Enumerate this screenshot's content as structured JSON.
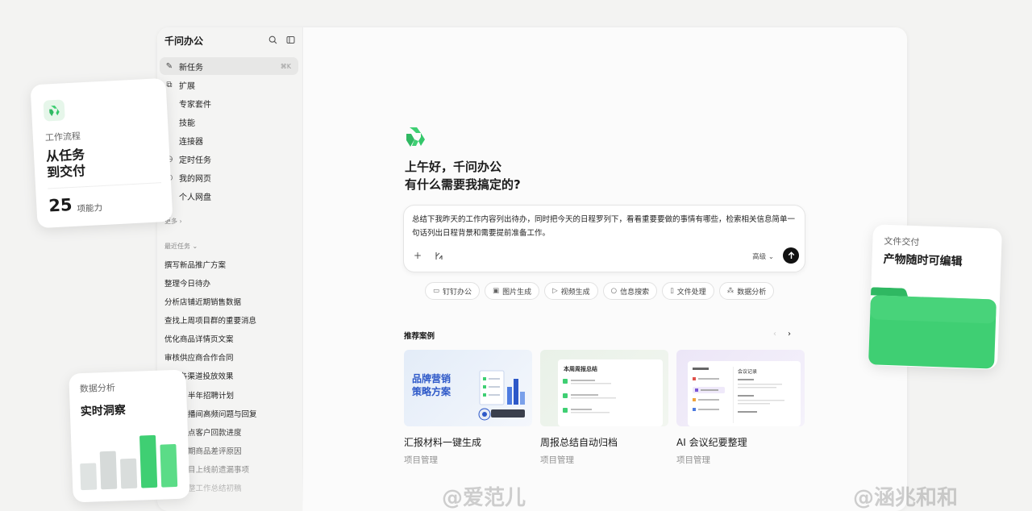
{
  "app": {
    "title": "千问办公",
    "sidebar": {
      "nav": [
        {
          "icon": "edit-icon",
          "label": "新任务",
          "shortcut": "⌘K"
        },
        {
          "icon": "extension-icon",
          "label": "扩展",
          "shortcut": ""
        },
        {
          "icon": "",
          "label": "专家套件",
          "shortcut": ""
        },
        {
          "icon": "",
          "label": "技能",
          "shortcut": ""
        },
        {
          "icon": "",
          "label": "连接器",
          "shortcut": ""
        },
        {
          "icon": "clock-icon",
          "label": "定时任务",
          "shortcut": ""
        },
        {
          "icon": "globe-icon",
          "label": "我的网页",
          "shortcut": ""
        },
        {
          "icon": "",
          "label": "个人网盘",
          "shortcut": ""
        }
      ],
      "more_label": "更多",
      "recent_label": "最近任务",
      "recent_tasks": [
        "撰写新品推广方案",
        "整理今日待办",
        "分析店铺近期销售数据",
        "查找上周项目群的重要消息",
        "优化商品详情页文案",
        "审核供应商合作合同",
        "统计各渠道投放效果",
        "半年招聘计划",
        "播间高频问题与回复",
        "点客户回款进度",
        "期商品差评原因",
        "目上线前遗漏事项",
        "整工作总结初稿"
      ]
    },
    "main": {
      "greeting_line1": "上午好，千问办公",
      "greeting_line2": "有什么需要我搞定的?",
      "prompt_text": "总结下我昨天的工作内容列出待办，同时把今天的日程罗列下，看看重要要做的事情有哪些，检索相关信息简单一句话列出日程背景和需要提前准备工作。",
      "advanced_label": "高级",
      "chips": [
        {
          "icon": "laptop-icon",
          "label": "钉钉办公"
        },
        {
          "icon": "image-icon",
          "label": "图片生成"
        },
        {
          "icon": "video-icon",
          "label": "视频生成"
        },
        {
          "icon": "search-icon",
          "label": "信息搜索"
        },
        {
          "icon": "file-icon",
          "label": "文件处理"
        },
        {
          "icon": "chart-icon",
          "label": "数据分析"
        }
      ],
      "recommend_title": "推荐案例",
      "cases": [
        {
          "title": "汇报材料一键生成",
          "subtitle": "项目管理",
          "thumb_text": "品牌营销\n策略方案"
        },
        {
          "title": "周报总结自动归档",
          "subtitle": "项目管理",
          "thumb_text": "本周周报总结"
        },
        {
          "title": "AI 会议纪要整理",
          "subtitle": "项目管理",
          "thumb_text": "会议记录"
        }
      ]
    }
  },
  "floating_cards": {
    "workflow": {
      "label": "工作流程",
      "headline": "从任务到交付",
      "number": "25",
      "unit": "项能力"
    },
    "analytics": {
      "label": "数据分析",
      "headline": "实时洞察"
    },
    "delivery": {
      "label": "文件交付",
      "headline": "产物随时可编辑"
    }
  },
  "watermarks": [
    "@爱范儿",
    "@涵兆和和"
  ],
  "colors": {
    "brand_green": "#3fcf73",
    "accent_green": "#34c76a"
  }
}
